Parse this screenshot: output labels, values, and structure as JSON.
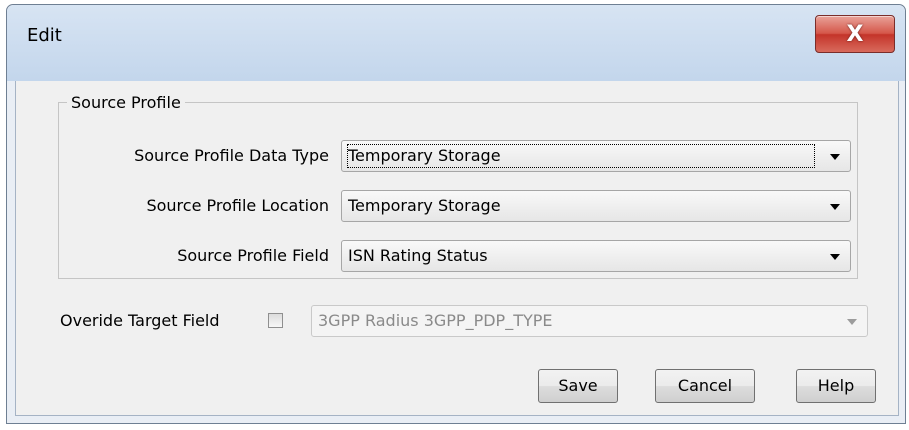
{
  "window": {
    "title": "Edit",
    "close_icon_label": "X"
  },
  "source_profile": {
    "legend": "Source Profile",
    "rows": [
      {
        "label": "Source Profile Data Type",
        "value": "Temporary Storage"
      },
      {
        "label": "Source Profile Location",
        "value": "Temporary Storage"
      },
      {
        "label": "Source Profile Field",
        "value": "ISN Rating Status"
      }
    ]
  },
  "override": {
    "label": "Overide Target Field",
    "checked": false,
    "value": "3GPP Radius 3GPP_PDP_TYPE",
    "enabled": false
  },
  "buttons": {
    "save": "Save",
    "cancel": "Cancel",
    "help": "Help"
  }
}
